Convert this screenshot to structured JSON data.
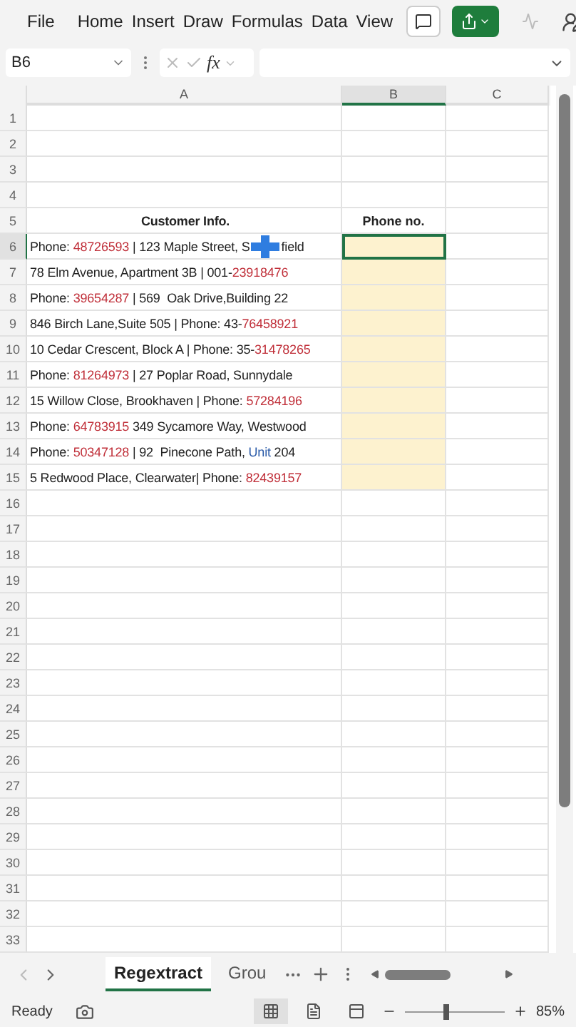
{
  "menu": {
    "items": [
      {
        "label": "File"
      },
      {
        "label": "Home"
      },
      {
        "label": "Insert"
      },
      {
        "label": "Draw"
      },
      {
        "label": "Formulas"
      },
      {
        "label": "Data"
      },
      {
        "label": "View"
      }
    ]
  },
  "formula_bar": {
    "name_box": "B6",
    "fx": "fx"
  },
  "columns": [
    {
      "label": "A",
      "selected": false
    },
    {
      "label": "B",
      "selected": true
    },
    {
      "label": "C",
      "selected": false
    }
  ],
  "rows": [
    {
      "number": "1",
      "kind": "empty",
      "selected": false,
      "fill": false
    },
    {
      "number": "2",
      "kind": "empty",
      "selected": false,
      "fill": false
    },
    {
      "number": "3",
      "kind": "empty",
      "selected": false,
      "fill": false
    },
    {
      "number": "4",
      "kind": "empty",
      "selected": false,
      "fill": false
    },
    {
      "number": "5",
      "kind": "heading",
      "a": "Customer Info.",
      "b": "Phone no.",
      "selected": false,
      "fill": false
    },
    {
      "number": "6",
      "kind": "data",
      "a": [
        {
          "text": "Phone: "
        },
        {
          "text": "48726593",
          "color": "#c0303a"
        },
        {
          "text": " | 123 Maple Street, S"
        }
      ],
      "a_tail": "field",
      "selected": true,
      "fill": true
    },
    {
      "number": "7",
      "kind": "data",
      "a": [
        {
          "text": "78 Elm Avenue, Apartment 3B | 001-"
        },
        {
          "text": "23918476",
          "color": "#c0303a"
        }
      ],
      "selected": false,
      "fill": true
    },
    {
      "number": "8",
      "kind": "data",
      "a": [
        {
          "text": "Phone: "
        },
        {
          "text": "39654287",
          "color": "#c0303a"
        },
        {
          "text": " | 569  Oak Drive,Building 22"
        }
      ],
      "selected": false,
      "fill": true
    },
    {
      "number": "9",
      "kind": "data",
      "a": [
        {
          "text": "846 Birch Lane,Suite 505 | Phone: 43-"
        },
        {
          "text": "76458921",
          "color": "#c0303a"
        }
      ],
      "selected": false,
      "fill": true
    },
    {
      "number": "10",
      "kind": "data",
      "a": [
        {
          "text": "10 Cedar Crescent, Block A | Phone: 35-"
        },
        {
          "text": "31478265",
          "color": "#c0303a"
        }
      ],
      "selected": false,
      "fill": true
    },
    {
      "number": "11",
      "kind": "data",
      "a": [
        {
          "text": "Phone: "
        },
        {
          "text": "81264973",
          "color": "#c0303a"
        },
        {
          "text": " | 27 Poplar Road, Sunnydale"
        }
      ],
      "selected": false,
      "fill": true
    },
    {
      "number": "12",
      "kind": "data",
      "a": [
        {
          "text": "15 Willow Close, Brookhaven | Phone: "
        },
        {
          "text": "57284196",
          "color": "#c0303a"
        }
      ],
      "selected": false,
      "fill": true
    },
    {
      "number": "13",
      "kind": "data",
      "a": [
        {
          "text": "Phone: "
        },
        {
          "text": "64783915",
          "color": "#c0303a"
        },
        {
          "text": " 349 Sycamore Way, Westwood"
        }
      ],
      "selected": false,
      "fill": true
    },
    {
      "number": "14",
      "kind": "data",
      "a": [
        {
          "text": "Phone: "
        },
        {
          "text": "50347128",
          "color": "#c0303a"
        },
        {
          "text": " | 92  Pinecone Path, "
        },
        {
          "text": "Unit",
          "color": "#2a5aa8"
        },
        {
          "text": " 204"
        }
      ],
      "selected": false,
      "fill": true
    },
    {
      "number": "15",
      "kind": "data",
      "a": [
        {
          "text": "5 Redwood Place, Clearwater| Phone: "
        },
        {
          "text": "82439157",
          "color": "#c0303a"
        }
      ],
      "selected": false,
      "fill": true
    },
    {
      "number": "16",
      "kind": "empty",
      "selected": false,
      "fill": false
    },
    {
      "number": "17",
      "kind": "empty",
      "selected": false,
      "fill": false
    },
    {
      "number": "18",
      "kind": "empty",
      "selected": false,
      "fill": false
    },
    {
      "number": "19",
      "kind": "empty",
      "selected": false,
      "fill": false
    },
    {
      "number": "20",
      "kind": "empty",
      "selected": false,
      "fill": false
    },
    {
      "number": "21",
      "kind": "empty",
      "selected": false,
      "fill": false
    },
    {
      "number": "22",
      "kind": "empty",
      "selected": false,
      "fill": false
    },
    {
      "number": "23",
      "kind": "empty",
      "selected": false,
      "fill": false
    },
    {
      "number": "24",
      "kind": "empty",
      "selected": false,
      "fill": false
    },
    {
      "number": "25",
      "kind": "empty",
      "selected": false,
      "fill": false
    },
    {
      "number": "26",
      "kind": "empty",
      "selected": false,
      "fill": false
    },
    {
      "number": "27",
      "kind": "empty",
      "selected": false,
      "fill": false
    },
    {
      "number": "28",
      "kind": "empty",
      "selected": false,
      "fill": false
    },
    {
      "number": "29",
      "kind": "empty",
      "selected": false,
      "fill": false
    },
    {
      "number": "30",
      "kind": "empty",
      "selected": false,
      "fill": false
    },
    {
      "number": "31",
      "kind": "empty",
      "selected": false,
      "fill": false
    },
    {
      "number": "32",
      "kind": "empty",
      "selected": false,
      "fill": false
    },
    {
      "number": "33",
      "kind": "empty",
      "selected": false,
      "fill": false
    }
  ],
  "sheet_tabs": [
    {
      "label": "Regextract",
      "selected": true
    },
    {
      "label": "Grou",
      "selected": false
    }
  ],
  "status_bar": {
    "status": "Ready",
    "views": [
      {
        "kind": "normal",
        "selected": true
      },
      {
        "kind": "layout",
        "selected": false
      },
      {
        "kind": "break",
        "selected": false
      }
    ],
    "zoom": {
      "level": 0.38,
      "reading": "85%"
    }
  }
}
